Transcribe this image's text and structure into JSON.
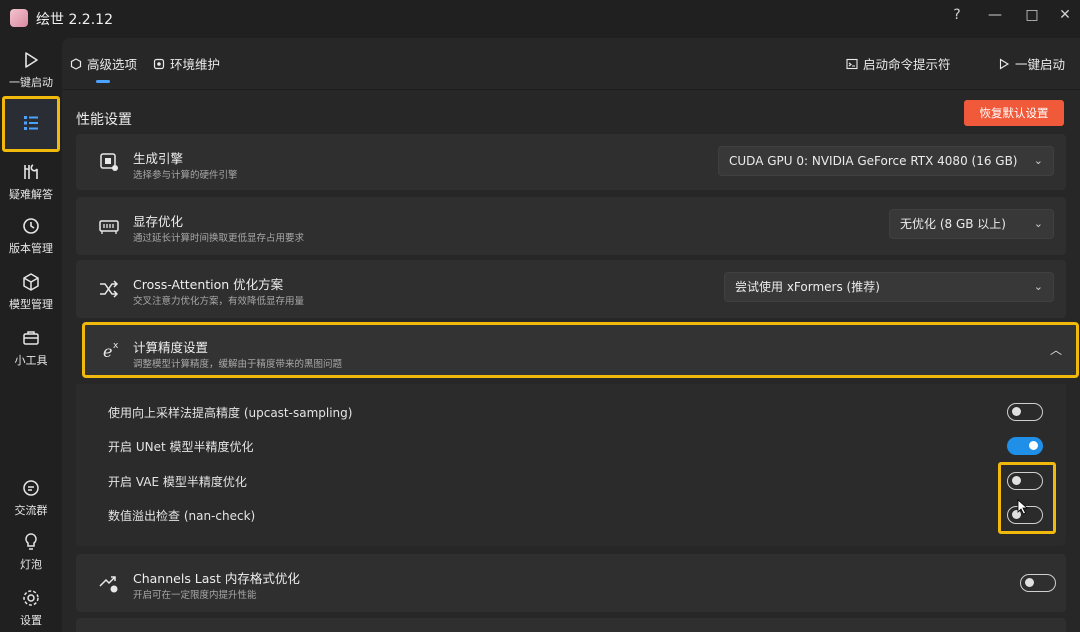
{
  "window": {
    "title": "绘世 2.2.12",
    "controls": [
      "?",
      "—",
      "□",
      "✕"
    ]
  },
  "nav": {
    "items": [
      {
        "label": "一键启动",
        "icon": "play-icon"
      },
      {
        "label": "",
        "icon": "list-settings-icon",
        "selected": true
      },
      {
        "label": "疑难解答",
        "icon": "tools-icon"
      },
      {
        "label": "版本管理",
        "icon": "history-icon"
      },
      {
        "label": "模型管理",
        "icon": "cube-icon"
      },
      {
        "label": "小工具",
        "icon": "toolbox-icon"
      },
      {
        "label": "交流群",
        "icon": "chat-icon"
      },
      {
        "label": "灯泡",
        "icon": "bulb-icon"
      },
      {
        "label": "设置",
        "icon": "gear-icon"
      }
    ]
  },
  "tabs": {
    "advanced": "高级选项",
    "env": "环境维护",
    "cmd_prompt": "启动命令提示符",
    "launch": "一键启动"
  },
  "section": {
    "title": "性能设置",
    "reset_label": "恢复默认设置"
  },
  "settings": {
    "engine": {
      "title": "生成引擎",
      "subtitle": "选择参与计算的硬件引擎",
      "value": "CUDA GPU 0: NVIDIA GeForce RTX 4080 (16 GB)"
    },
    "vram": {
      "title": "显存优化",
      "subtitle": "通过延长计算时间换取更低显存占用要求",
      "value": "无优化 (8 GB 以上)"
    },
    "attention": {
      "title": "Cross-Attention 优化方案",
      "subtitle": "交叉注意力优化方案，有效降低显存用量",
      "value": "尝试使用 xFormers (推荐)"
    },
    "precision": {
      "title": "计算精度设置",
      "subtitle": "调整模型计算精度，缓解由于精度带来的黑图问题",
      "options": [
        {
          "label": "使用向上采样法提高精度 (upcast-sampling)",
          "on": false
        },
        {
          "label": "开启 UNet 模型半精度优化",
          "on": true
        },
        {
          "label": "开启 VAE 模型半精度优化",
          "on": false
        },
        {
          "label": "数值溢出检查 (nan-check)",
          "on": false
        }
      ]
    },
    "channels_last": {
      "title": "Channels Last 内存格式优化",
      "subtitle": "开启可在一定限度内提升性能",
      "on": false
    }
  },
  "colors": {
    "accent": "#1f8fe8",
    "highlight": "#f0b90b",
    "danger": "#f05a3a"
  }
}
